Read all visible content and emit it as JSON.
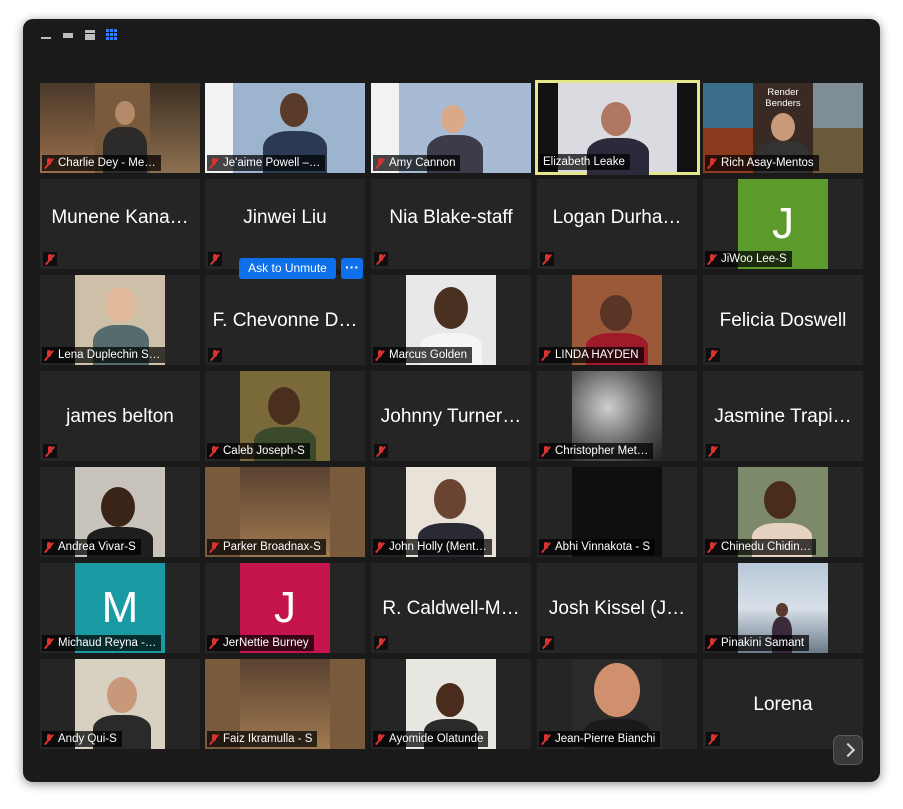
{
  "window": {
    "layout_buttons": [
      "minimize-view",
      "strip-view",
      "speaker-view",
      "gallery-view"
    ]
  },
  "tiles": [
    {
      "name": "Charlie Dey - Me…"
    },
    {
      "name": "Je'aime Powell –…"
    },
    {
      "name": "Amy Cannon"
    },
    {
      "name": "Elizabeth Leake"
    },
    {
      "name": "Rich Asay-Mentos",
      "background_text": "Render Benders"
    },
    {
      "name": "Munene Kana…"
    },
    {
      "name": "Jinwei Liu"
    },
    {
      "name": "Nia Blake-staff"
    },
    {
      "name": "Logan Durha…"
    },
    {
      "name": "JiWoo Lee-S",
      "avatar": "J",
      "avatar_color": "#5c9a2c"
    },
    {
      "name": "Lena Duplechin S…"
    },
    {
      "name": "F. Chevonne D…"
    },
    {
      "name": "Marcus Golden"
    },
    {
      "name": "LINDA HAYDEN"
    },
    {
      "name": "Felicia Doswell"
    },
    {
      "name": "james belton"
    },
    {
      "name": "Caleb Joseph-S"
    },
    {
      "name": "Johnny Turner…"
    },
    {
      "name": "Christopher Met…"
    },
    {
      "name": "Jasmine Trapi…"
    },
    {
      "name": "Andrea Vivar-S"
    },
    {
      "name": "Parker Broadnax-S"
    },
    {
      "name": "John Holly (Ment…"
    },
    {
      "name": "Abhi Vinnakota - S"
    },
    {
      "name": "Chinedu Chidin…"
    },
    {
      "name": "Michaud Reyna -…",
      "avatar": "M",
      "avatar_color": "#1a9aa3"
    },
    {
      "name": "JerNettie Burney",
      "avatar": "J",
      "avatar_color": "#c4144b"
    },
    {
      "name": "R.  Caldwell-M…"
    },
    {
      "name": "Josh Kissel (J…"
    },
    {
      "name": "Pinakini Samant"
    },
    {
      "name": "Andy Qui-S"
    },
    {
      "name": "Faiz Ikramulla - S"
    },
    {
      "name": "Ayomide Olatunde"
    },
    {
      "name": "Jean-Pierre Bianchi"
    },
    {
      "name": "Lorena"
    }
  ],
  "controls": {
    "ask_to_unmute": "Ask to Unmute",
    "more": "···"
  }
}
